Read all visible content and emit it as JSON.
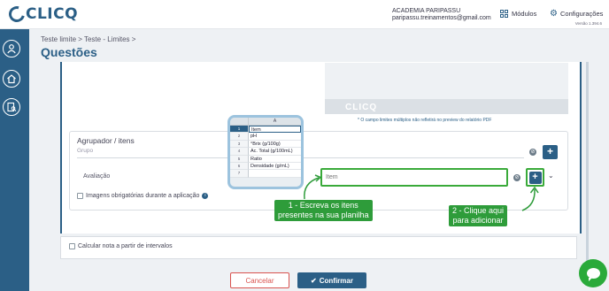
{
  "app": {
    "logo_text": "CLICQ",
    "brand_color": "#2b5f86",
    "accent_green": "#2e9c3a"
  },
  "header": {
    "account_name": "ACADEMIA PARIPASSU",
    "account_email": "paripassu.treinamentos@gmail.com",
    "modules_label": "Módulos",
    "modules_icon": "grid-icon",
    "settings_label": "Configurações",
    "settings_icon": "gear-icon",
    "version": "Versão 1.394.6"
  },
  "sidebar": {
    "items": [
      {
        "icon": "user-icon"
      },
      {
        "icon": "home-icon"
      },
      {
        "icon": "checklist-search-icon"
      }
    ]
  },
  "breadcrumb": "Teste limite > Teste - Limites >",
  "page_title": "Questões",
  "preview": {
    "logo_text": "CLICQ",
    "note": "* O campo limites múltiplos não refletirá no preview do relatório PDF"
  },
  "group": {
    "label": "Agrupador / itens",
    "field_label": "Grupo",
    "evaluation_label": "Avaliação",
    "item_placeholder": "Item",
    "add_symbol": "+",
    "mandatory_images_label": "Imagens obrigatórias durante a aplicação",
    "info_symbol": "i"
  },
  "spreadsheet": {
    "column_header": "A",
    "rows": [
      {
        "num": "1",
        "value": "Item"
      },
      {
        "num": "2",
        "value": "pH"
      },
      {
        "num": "3",
        "value": "°Brix (g/100g)"
      },
      {
        "num": "4",
        "value": "Ac. Total (g/100mL)"
      },
      {
        "num": "5",
        "value": "Ratio"
      },
      {
        "num": "6",
        "value": "Densidade (g/mL)"
      },
      {
        "num": "7",
        "value": ""
      }
    ]
  },
  "callouts": {
    "step1_line1": "1 - Escreva os itens",
    "step1_line2": "presentes na sua planilha",
    "step2_line1": "2 - Clique aqui",
    "step2_line2": "para adicionar"
  },
  "intervals": {
    "label": "Calcular nota a partir de intervalos"
  },
  "footer": {
    "cancel_label": "Cancelar",
    "confirm_label": "Confirmar"
  }
}
